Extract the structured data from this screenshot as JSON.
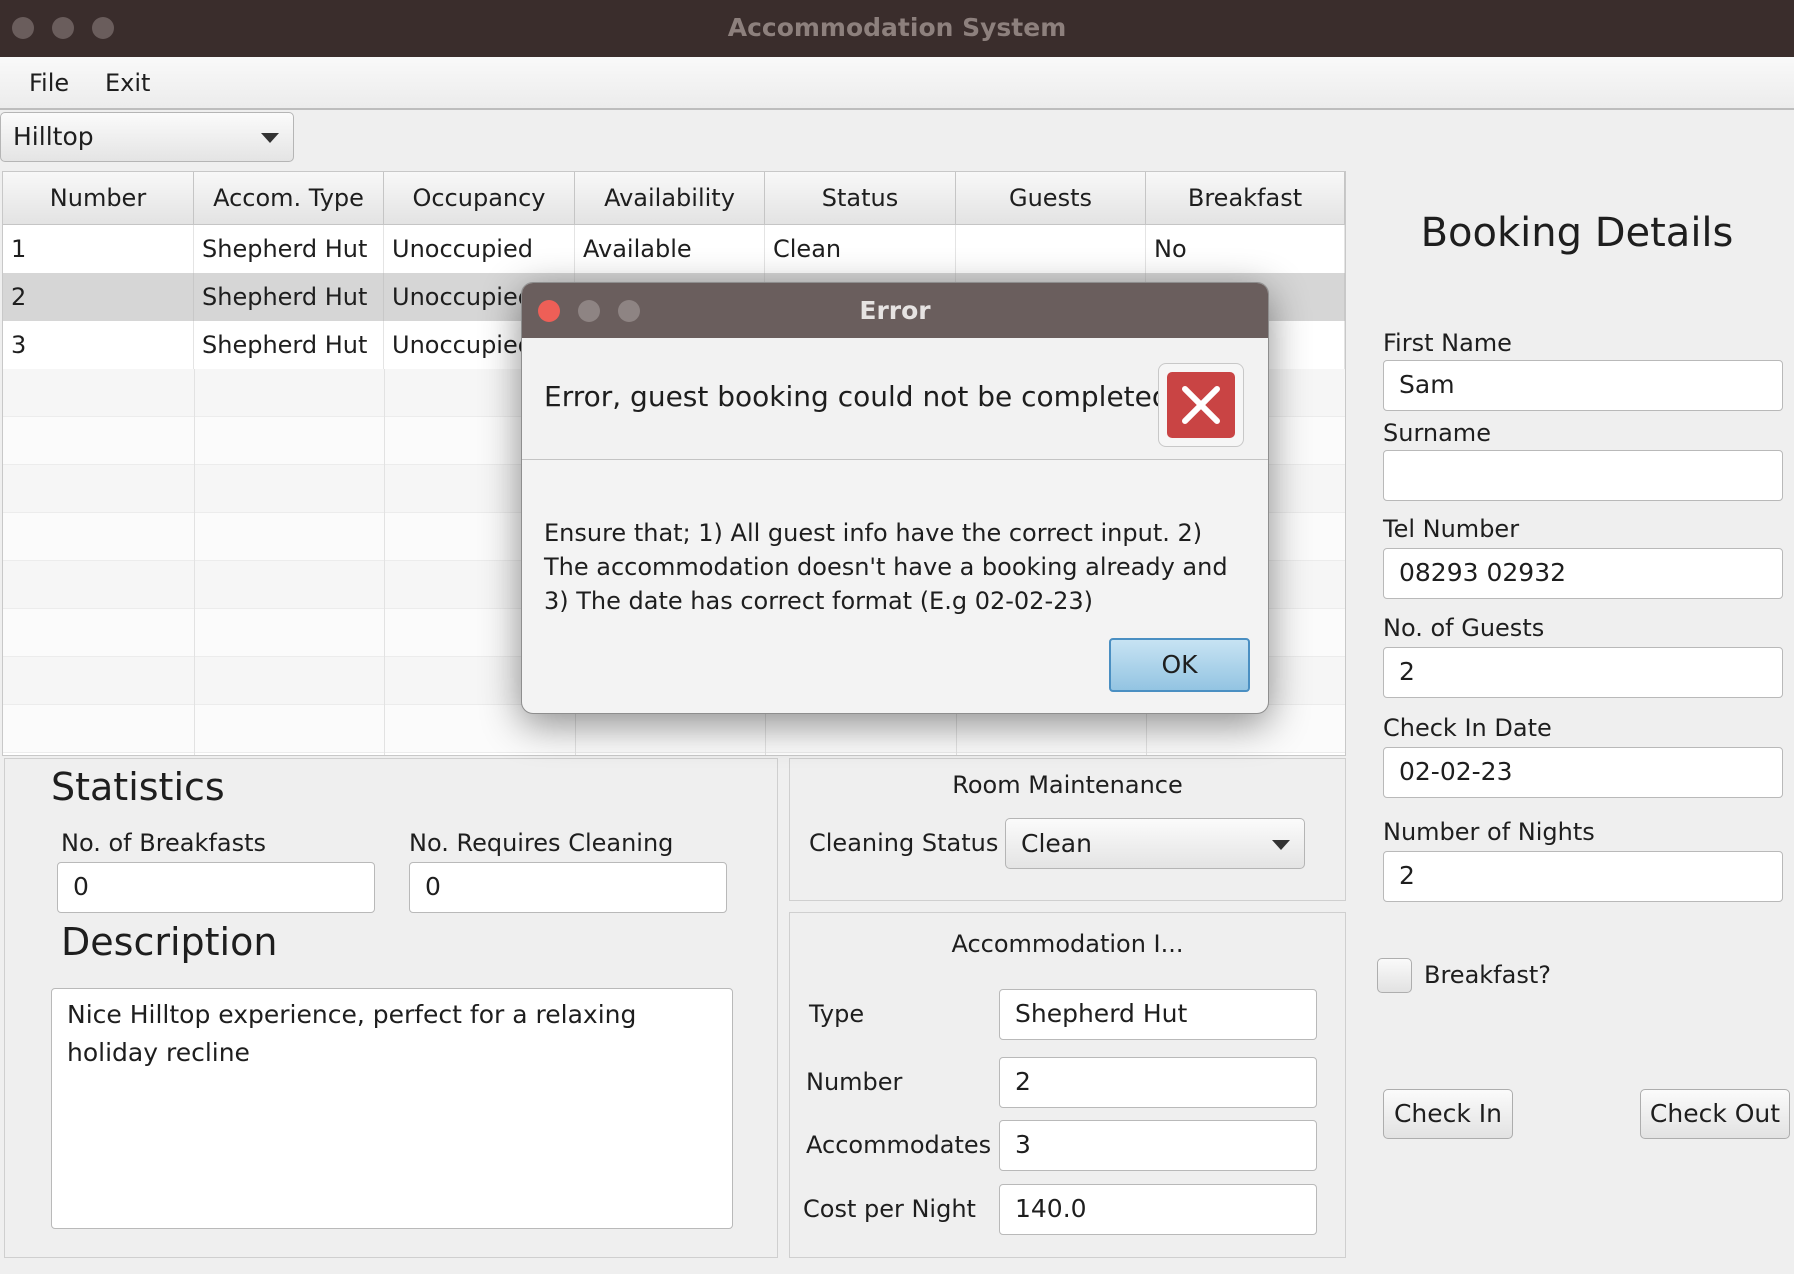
{
  "window": {
    "title": "Accommodation System"
  },
  "menu": {
    "file": "File",
    "exit": "Exit"
  },
  "location_select": {
    "value": "Hilltop"
  },
  "table": {
    "columns": [
      "Number",
      "Accom. Type",
      "Occupancy",
      "Availability",
      "Status",
      "Guests",
      "Breakfast"
    ],
    "rows": [
      [
        "1",
        "Shepherd Hut",
        "Unoccupied",
        "Available",
        "Clean",
        "",
        "No"
      ],
      [
        "2",
        "Shepherd Hut",
        "Unoccupied",
        "",
        "",
        "",
        ""
      ],
      [
        "3",
        "Shepherd Hut",
        "Unoccupied",
        "",
        "",
        "",
        ""
      ]
    ],
    "selected_row": 2
  },
  "statistics": {
    "title": "Statistics",
    "breakfasts_label": "No. of Breakfasts",
    "breakfasts_value": "0",
    "cleaning_label": "No. Requires Cleaning",
    "cleaning_value": "0"
  },
  "description": {
    "title": "Description",
    "text": "Nice Hilltop experience, perfect for a relaxing holiday recline"
  },
  "maintenance": {
    "title": "Room Maintenance",
    "cleaning_label": "Cleaning Status",
    "cleaning_value": "Clean"
  },
  "accommodation_info": {
    "title": "Accommodation I...",
    "type_label": "Type",
    "type_value": "Shepherd Hut",
    "number_label": "Number",
    "number_value": "2",
    "accommodates_label": "Accommodates",
    "accommodates_value": "3",
    "cost_label": "Cost per Night",
    "cost_value": "140.0"
  },
  "booking": {
    "title": "Booking Details",
    "first_name_label": "First Name",
    "first_name_value": "Sam",
    "surname_label": "Surname",
    "surname_value": "",
    "tel_label": "Tel Number",
    "tel_value": "08293 02932",
    "guests_label": "No. of Guests",
    "guests_value": "2",
    "checkin_label": "Check In Date",
    "checkin_value": "02-02-23",
    "nights_label": "Number of Nights",
    "nights_value": "2",
    "breakfast_label": "Breakfast?",
    "breakfast_checked": false,
    "check_in_button": "Check In",
    "check_out_button": "Check Out"
  },
  "dialog": {
    "title": "Error",
    "header": "Error, guest booking could not be completed.",
    "message": "Ensure that; 1) All guest info have the correct input. 2) The accommodation doesn't have a booking already and 3) The date has correct format (E.g 02-02-23)",
    "ok_label": "OK",
    "icon": "error-x-icon"
  },
  "colors": {
    "titlebar": "#3a2d2c",
    "dialog_titlebar": "#6a5e5d",
    "error_icon": "#c94444",
    "ok_button": "#a9d2ea"
  }
}
